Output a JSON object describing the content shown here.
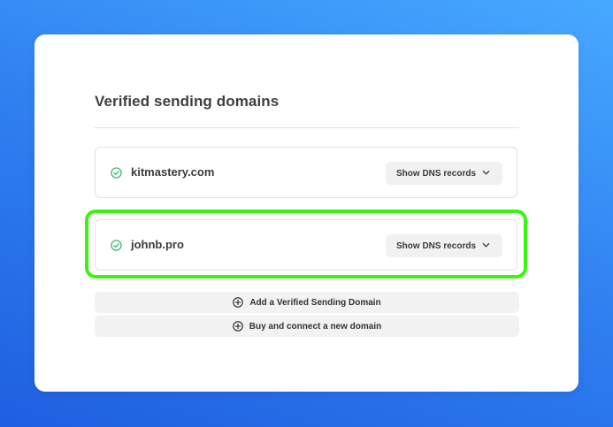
{
  "panel": {
    "title": "Verified sending domains"
  },
  "domains": [
    {
      "name": "kitmastery.com",
      "status_icon": "check-circle-icon",
      "dns_button_label": "Show DNS records",
      "highlighted": false
    },
    {
      "name": "johnb.pro",
      "status_icon": "check-circle-icon",
      "dns_button_label": "Show DNS records",
      "highlighted": true
    }
  ],
  "actions": {
    "add_label": "Add a Verified Sending Domain",
    "buy_label": "Buy and connect a new domain",
    "icon": "plus-circle-icon"
  },
  "colors": {
    "verified_green": "#35b36a",
    "highlight_border": "#3cf50f",
    "background_blue": "#2f7ff0"
  }
}
